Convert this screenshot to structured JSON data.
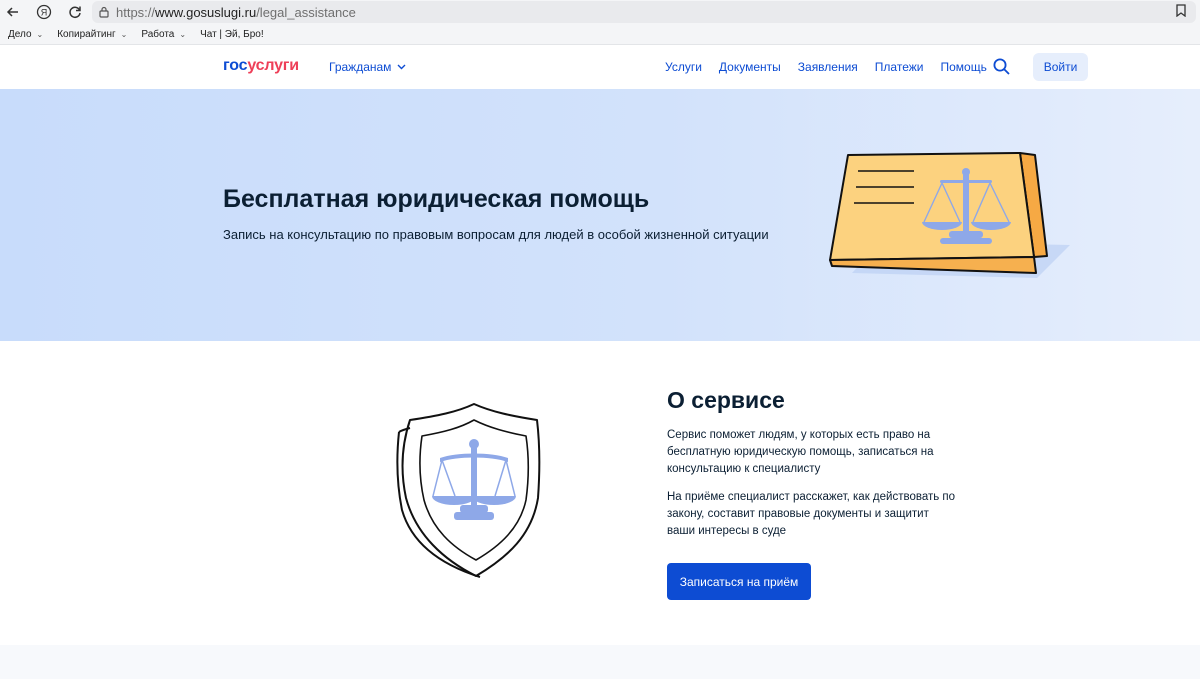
{
  "browser": {
    "url_prefix": "https://",
    "url_host": "www.gosuslugi.ru",
    "url_path": "/legal_assistance",
    "bookmarks": [
      {
        "label": "Дело"
      },
      {
        "label": "Копирайтинг"
      },
      {
        "label": "Работа"
      },
      {
        "label": "Чат | Эй, Бро!"
      }
    ]
  },
  "header": {
    "logo_part1": "гос",
    "logo_part2": "услуги",
    "audience": "Гражданам",
    "nav": [
      "Услуги",
      "Документы",
      "Заявления",
      "Платежи",
      "Помощь"
    ],
    "login": "Войти"
  },
  "hero": {
    "title": "Бесплатная юридическая помощь",
    "subtitle": "Запись на консультацию по правовым вопросам для людей в особой жизненной ситуации"
  },
  "about": {
    "title": "О сервисе",
    "p1": "Сервис поможет людям, у которых есть право на бесплатную юридическую помощь, записаться на консультацию к специалисту",
    "p2": "На приёме специалист расскажет, как действовать по закону, составит правовые документы и защитит ваши интересы в суде",
    "cta": "Записаться на приём"
  },
  "colors": {
    "brand_blue": "#0d4cd3",
    "brand_red": "#ee3f58",
    "hero_bg": "#c8dcfb",
    "text": "#0b1f33"
  }
}
